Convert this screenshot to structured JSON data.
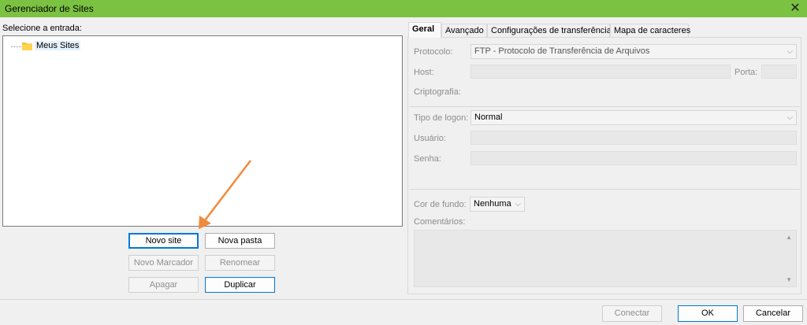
{
  "window": {
    "title": "Gerenciador de Sites",
    "close_glyph": "✕"
  },
  "left": {
    "select_label": "Selecione a entrada:",
    "tree": [
      {
        "label": "Meus Sites",
        "icon": "folder-icon"
      }
    ],
    "buttons": {
      "new_site": "Novo site",
      "new_folder": "Nova pasta",
      "new_bookmark": "Novo Marcador",
      "rename": "Renomear",
      "delete": "Apagar",
      "duplicate": "Duplicar"
    }
  },
  "tabs": [
    "Geral",
    "Avançado",
    "Configurações de transferência",
    "Mapa de caracteres"
  ],
  "general": {
    "protocol_label": "Protocolo:",
    "protocol_value": "FTP - Protocolo de Transferência de Arquivos",
    "host_label": "Host:",
    "host_value": "",
    "port_label": "Porta:",
    "port_value": "",
    "encryption_label": "Criptografia:",
    "logon_type_label": "Tipo de logon:",
    "logon_type_value": "Normal",
    "user_label": "Usuário:",
    "password_label": "Senha:",
    "bg_color_label": "Cor de fundo:",
    "bg_color_value": "Nenhuma",
    "comments_label": "Comentários:"
  },
  "footer": {
    "connect": "Conectar",
    "ok": "OK",
    "cancel": "Cancelar"
  },
  "colors": {
    "titlebar": "#7cc242",
    "annotation_arrow": "#f08a3c",
    "folder": "#f7c131"
  }
}
